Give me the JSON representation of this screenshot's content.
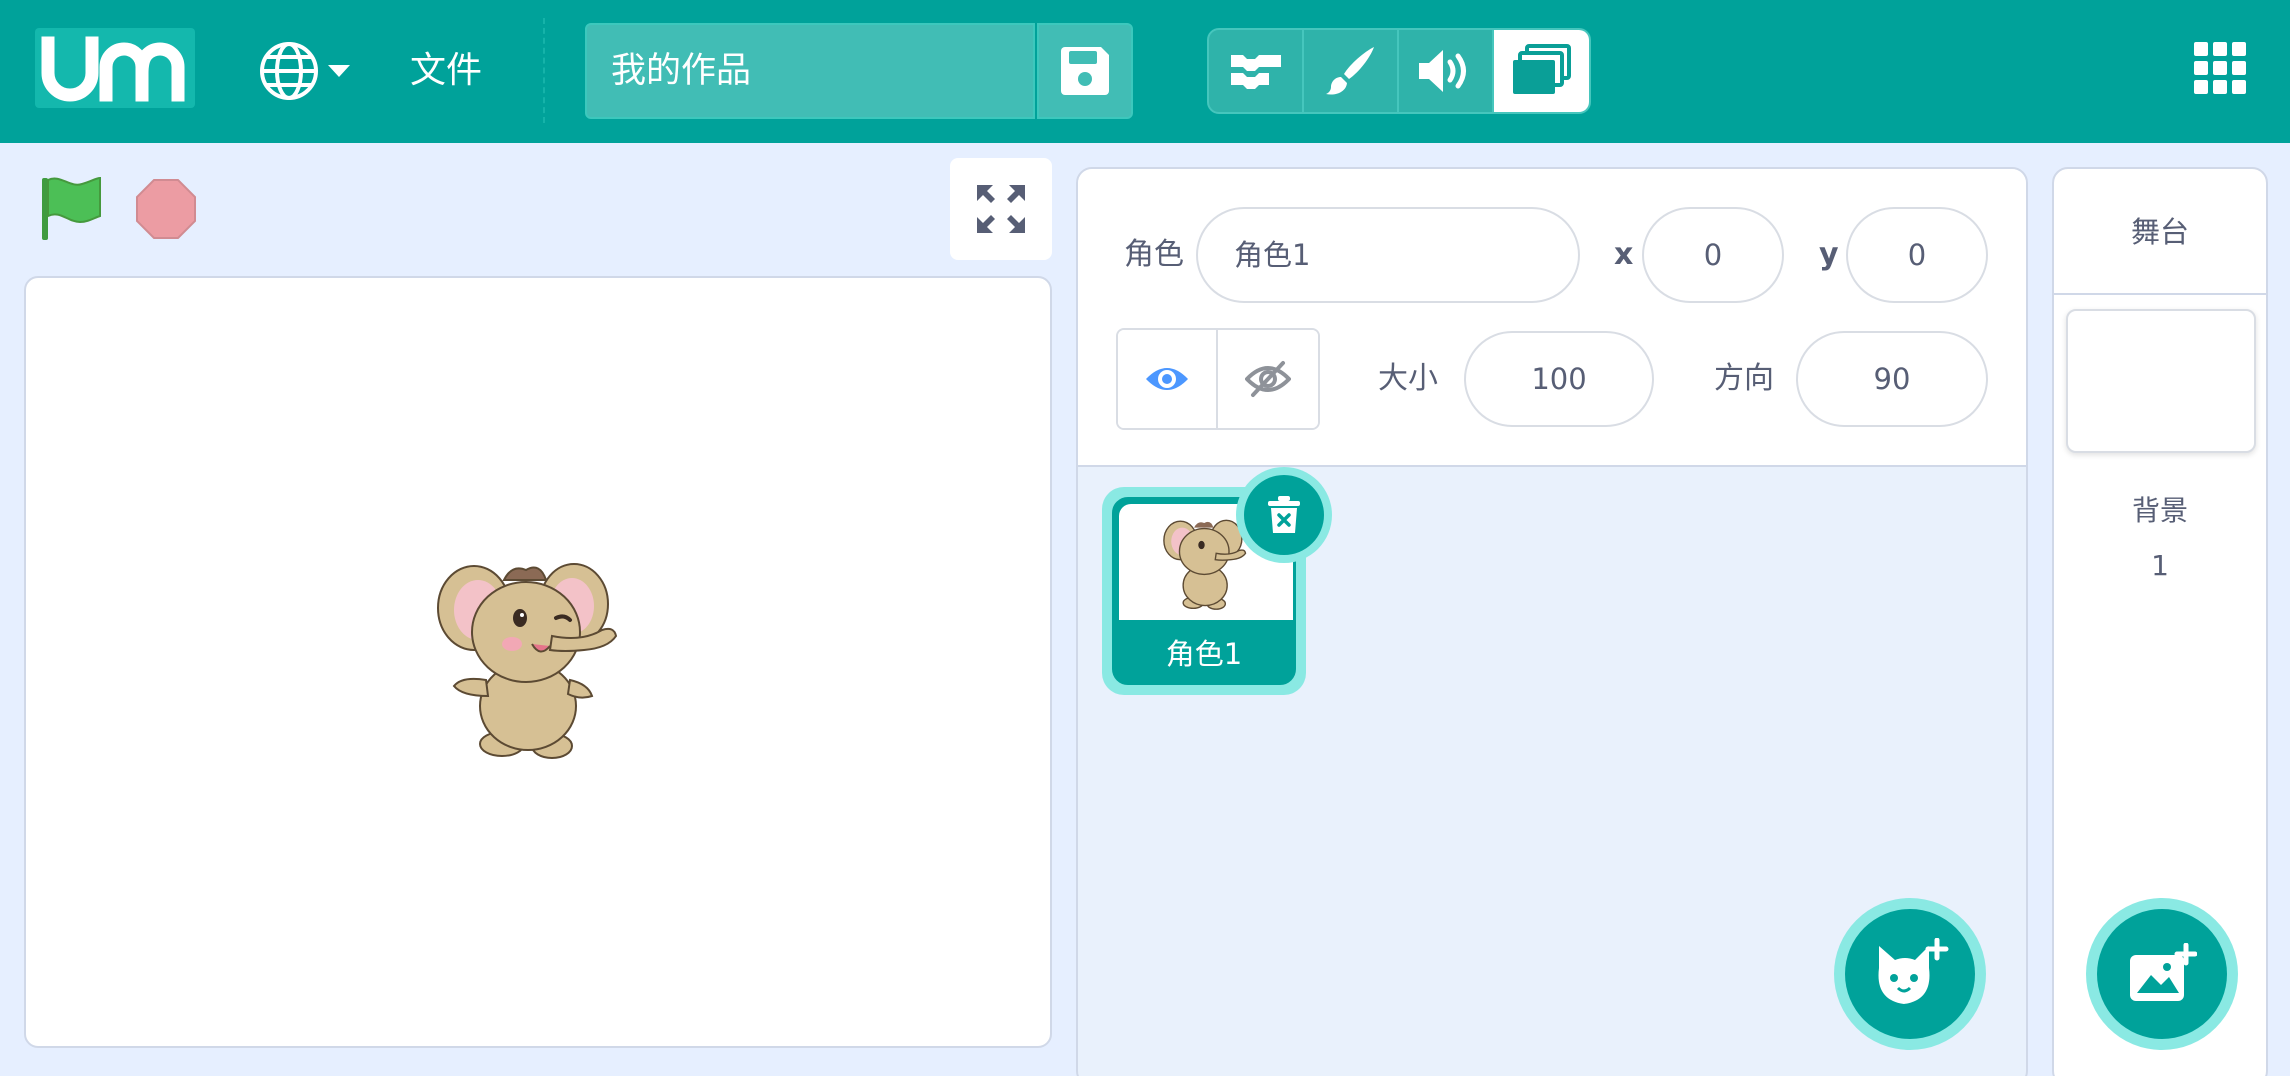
{
  "menubar": {
    "logo_text": "um",
    "file_label": "文件",
    "project_title": "我的作品"
  },
  "sprite_info": {
    "sprite_label": "角色",
    "sprite_name": "角色1",
    "x_label": "x",
    "x_value": "0",
    "y_label": "y",
    "y_value": "0",
    "size_label": "大小",
    "size_value": "100",
    "direction_label": "方向",
    "direction_value": "90"
  },
  "sprites": [
    {
      "name": "角色1",
      "selected": true
    }
  ],
  "stage_panel": {
    "title": "舞台",
    "backdrop_label": "背景",
    "backdrop_count": "1"
  },
  "colors": {
    "accent": "#00a29a",
    "accent_light": "#8ae9e3",
    "background": "#e6efff"
  },
  "icons": {
    "language": "globe-icon",
    "save": "floppy-disk-icon",
    "tabs": [
      "code-blocks-icon",
      "paintbrush-icon",
      "speaker-icon",
      "stage-layers-icon"
    ],
    "apps": "grid-apps-icon",
    "run": "green-flag-icon",
    "stop": "stop-sign-icon",
    "fullscreen": "expand-arrows-icon",
    "show": "eye-icon",
    "hide": "eye-slash-icon",
    "delete": "trash-icon",
    "add_sprite": "cat-plus-icon",
    "add_backdrop": "image-plus-icon"
  }
}
